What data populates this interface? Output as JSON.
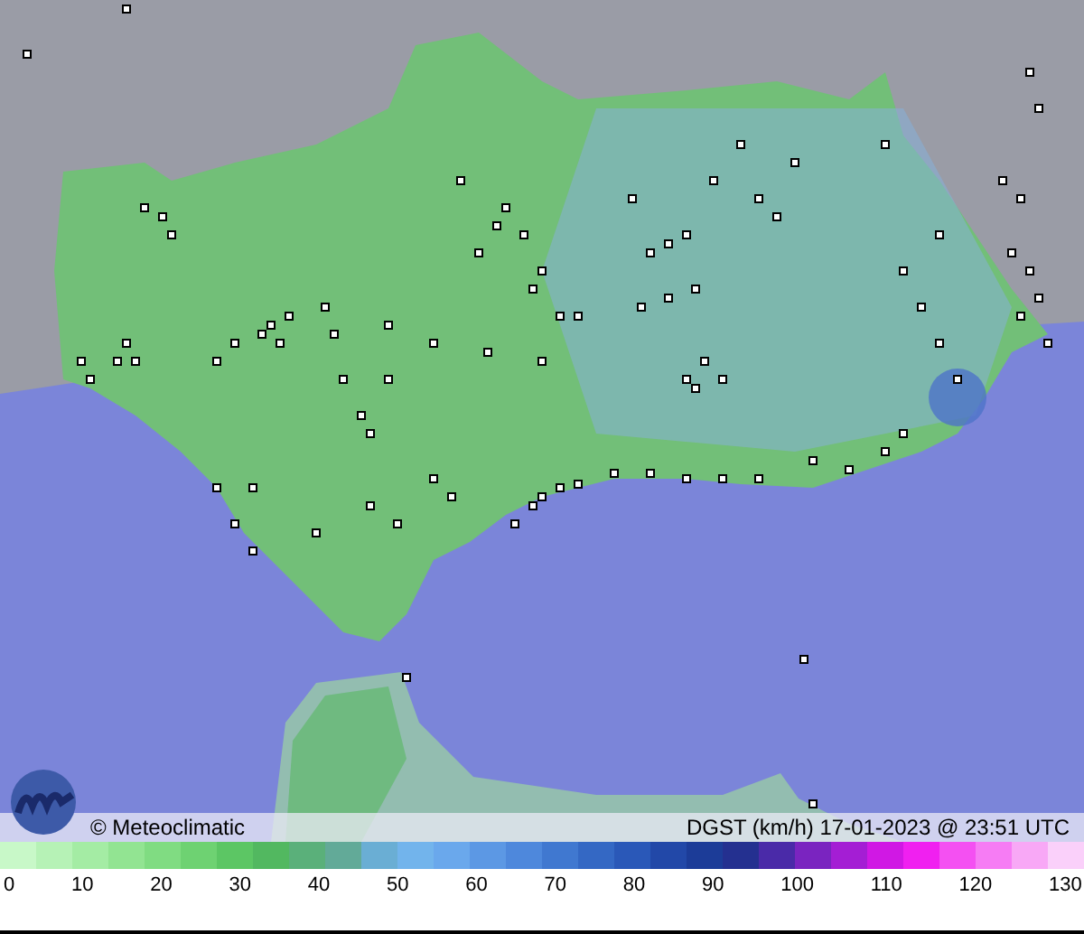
{
  "caption": {
    "credit": "© Meteoclimatic",
    "title": "DGST (km/h)  17-01-2023 @ 23:51 UTC"
  },
  "legend": {
    "ticks": [
      "0",
      "10",
      "20",
      "30",
      "40",
      "50",
      "60",
      "70",
      "80",
      "90",
      "100",
      "110",
      "120",
      "130"
    ]
  }
}
